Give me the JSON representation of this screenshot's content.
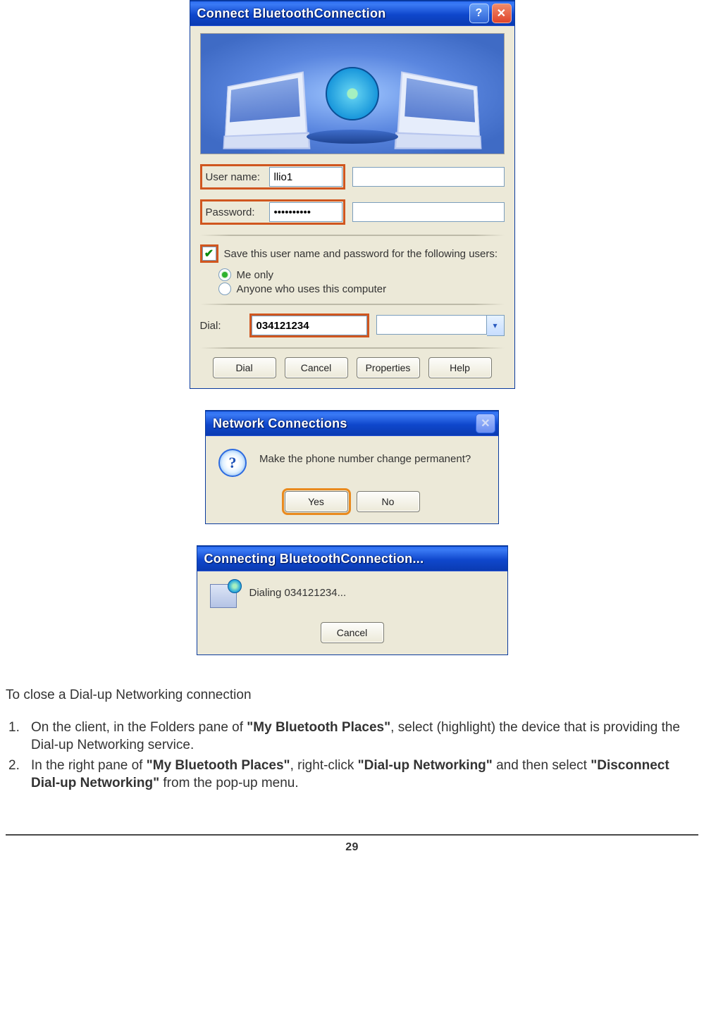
{
  "connect": {
    "title": "Connect BluetoothConnection",
    "username_label": "User name:",
    "username_value": "llio1",
    "password_label": "Password:",
    "password_value": "••••••••••",
    "save_label": "Save this user name and password for the following users:",
    "save_checked": true,
    "radio_me": "Me only",
    "radio_anyone": "Anyone who uses this computer",
    "radio_selected": "me",
    "dial_label": "Dial:",
    "dial_value": "034121234",
    "buttons": {
      "dial": "Dial",
      "cancel": "Cancel",
      "properties": "Properties",
      "help": "Help"
    }
  },
  "network": {
    "title": "Network Connections",
    "message": "Make the phone number change permanent?",
    "yes": "Yes",
    "no": "No"
  },
  "connecting": {
    "title": "Connecting BluetoothConnection...",
    "status": "Dialing 034121234...",
    "cancel": "Cancel"
  },
  "body": {
    "heading": "To close a Dial-up Networking connection",
    "step1_a": "On the client, in the Folders pane of ",
    "step1_b": "\"My Bluetooth Places\"",
    "step1_c": ", select (highlight) the device that is providing the Dial-up Networking service.",
    "step2_a": "In the right pane of ",
    "step2_b": "\"My Bluetooth Places\"",
    "step2_c": ", right-click ",
    "step2_d": "\"Dial-up Networking\"",
    "step2_e": " and then select ",
    "step2_f": "\"Disconnect Dial-up Networking\"",
    "step2_g": " from the pop-up menu."
  },
  "page_number": "29"
}
